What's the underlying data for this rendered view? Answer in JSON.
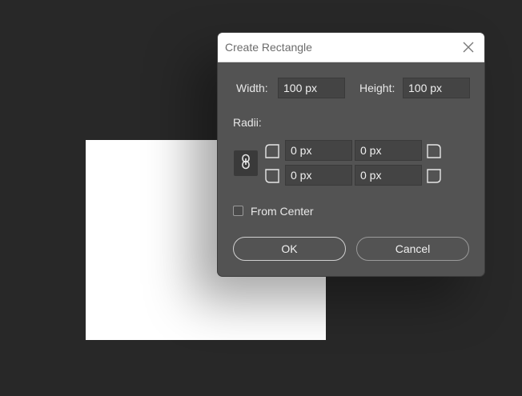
{
  "dialog": {
    "title": "Create Rectangle",
    "width_label": "Width:",
    "width_value": "100 px",
    "height_label": "Height:",
    "height_value": "100 px",
    "radii_label": "Radii:",
    "radius_top_left": "0 px",
    "radius_top_right": "0 px",
    "radius_bottom_left": "0 px",
    "radius_bottom_right": "0 px",
    "from_center_label": "From Center",
    "from_center_checked": false,
    "ok_label": "OK",
    "cancel_label": "Cancel"
  },
  "icons": {
    "close": "close-icon",
    "link": "chain-link-icon",
    "corners": [
      "corner-top-left-icon",
      "corner-top-right-icon",
      "corner-bottom-left-icon",
      "corner-bottom-right-icon"
    ]
  },
  "colors": {
    "canvas_bg": "#282828",
    "dialog_bg": "#535353",
    "field_bg": "#444444",
    "rectangle_fill": "#ffffff"
  }
}
